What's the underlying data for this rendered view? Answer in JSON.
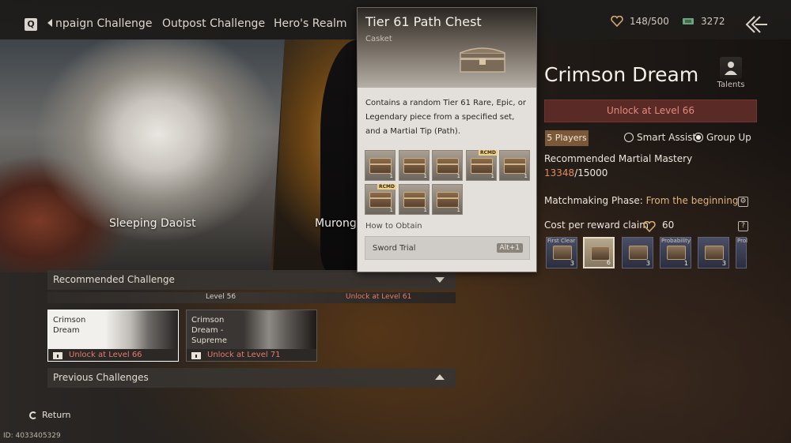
{
  "topbar": {
    "q_key": "Q",
    "tabs": [
      "npaign Challenge",
      "Outpost Challenge",
      "Hero's Realm"
    ],
    "resources": [
      {
        "icon": "heart-icon",
        "value": "148/500"
      },
      {
        "icon": "cash-icon",
        "value": "3272"
      }
    ]
  },
  "artwork": {
    "left_name": "Sleeping Daoist",
    "mid_name": "Murong"
  },
  "tooltip": {
    "title": "Tier 61 Path Chest",
    "subtitle": "Casket",
    "description": "Contains a random Tier 61 Rare, Epic, or Legendary piece from a specified set, and a Martial Tip (Path).",
    "items": [
      {
        "count": "1",
        "rcmd": ""
      },
      {
        "count": "1",
        "rcmd": ""
      },
      {
        "count": "1",
        "rcmd": ""
      },
      {
        "count": "1",
        "rcmd": "RCMD"
      },
      {
        "count": "1",
        "rcmd": ""
      },
      {
        "count": "1",
        "rcmd": "RCMD"
      },
      {
        "count": "1",
        "rcmd": ""
      },
      {
        "count": "1",
        "rcmd": ""
      }
    ],
    "how_to_obtain": "How to Obtain",
    "source_name": "Sword Trial",
    "source_key": "Alt+1"
  },
  "panel": {
    "title": "Crimson Dream",
    "talents_label": "Talents",
    "unlock_text": "Unlock at Level 66",
    "players_badge": "5 Players",
    "smart_assist": "Smart Assist",
    "group_up": "Group Up",
    "group_up_selected": true,
    "mastery_label": "Recommended Martial Mastery",
    "mastery_current": "13348",
    "mastery_required": "/15000",
    "matchmaking_label": "Matchmaking Phase: ",
    "matchmaking_value": "From the beginning",
    "cost_label": "Cost per reward claim",
    "cost_value": "60",
    "help_glyph": "?",
    "rewards": [
      {
        "label": "First Clear",
        "count": "3",
        "selected": false
      },
      {
        "label": "",
        "count": "6",
        "selected": true
      },
      {
        "label": "",
        "count": "3",
        "selected": false
      },
      {
        "label": "Probability",
        "count": "1",
        "selected": false
      },
      {
        "label": "",
        "count": "3",
        "selected": false
      },
      {
        "label": "Prol",
        "count": "",
        "selected": false
      }
    ]
  },
  "challenges": {
    "recommended_label": "Recommended Challenge",
    "strip_left": "Level 56",
    "strip_right": "Unlock at Level 61",
    "cards": [
      {
        "name": "Crimson Dream",
        "lock": "Unlock at Level 66"
      },
      {
        "name": "Crimson Dream - Supreme",
        "lock": "Unlock at Level 71"
      }
    ],
    "previous_label": "Previous Challenges"
  },
  "footer": {
    "return_label": "Return",
    "id_text": "ID: 4033405329"
  },
  "colors": {
    "unlock_red": "#e07d6e",
    "accent_gold": "#e0b47c",
    "mastery_orange": "#e28b5f"
  }
}
